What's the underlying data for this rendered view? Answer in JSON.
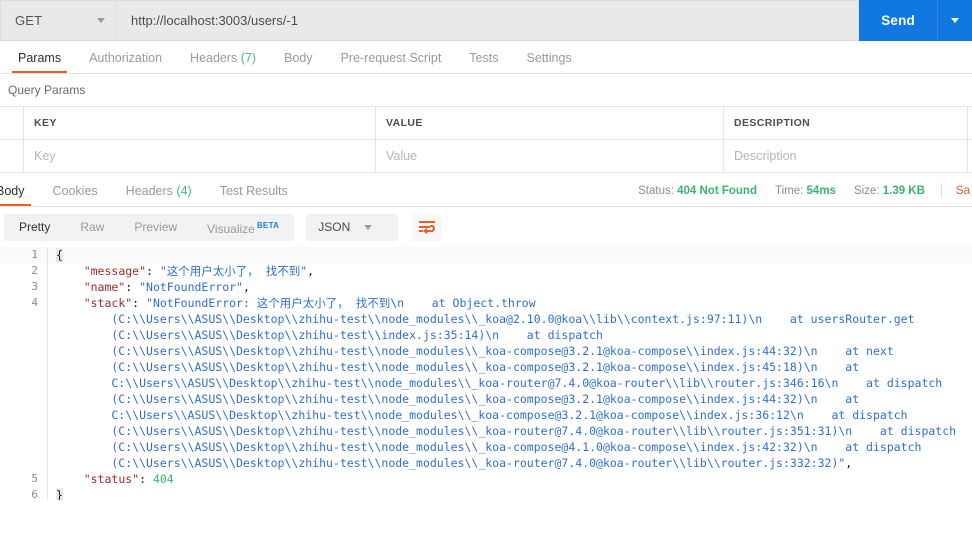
{
  "request": {
    "method": "GET",
    "method_caret_icon": "chevron-down-icon",
    "url": "http://localhost:3003/users/-1",
    "send_label": "Send",
    "send_caret_icon": "chevron-down-icon"
  },
  "request_tabs": [
    {
      "label": "Params",
      "active": true
    },
    {
      "label": "Authorization",
      "active": false
    },
    {
      "label": "Headers",
      "count": "(7)",
      "active": false
    },
    {
      "label": "Body",
      "active": false
    },
    {
      "label": "Pre-request Script",
      "active": false
    },
    {
      "label": "Tests",
      "active": false
    },
    {
      "label": "Settings",
      "active": false
    }
  ],
  "query_params": {
    "section_title": "Query Params",
    "columns": [
      "KEY",
      "VALUE",
      "DESCRIPTION"
    ],
    "placeholder_row": [
      "Key",
      "Value",
      "Description"
    ]
  },
  "response_tabs": [
    {
      "label": "Body",
      "active": true
    },
    {
      "label": "Cookies",
      "active": false
    },
    {
      "label": "Headers",
      "count": "(4)",
      "active": false
    },
    {
      "label": "Test Results",
      "active": false
    }
  ],
  "response_meta": {
    "status_label": "Status:",
    "status_value": "404 Not Found",
    "time_label": "Time:",
    "time_value": "54ms",
    "size_label": "Size:",
    "size_value": "1.39 KB",
    "save_response": "Sa"
  },
  "format_bar": {
    "tabs": [
      {
        "label": "Pretty",
        "active": true
      },
      {
        "label": "Raw",
        "active": false
      },
      {
        "label": "Preview",
        "active": false
      },
      {
        "label": "Visualize",
        "badge": "BETA",
        "active": false
      }
    ],
    "language": "JSON",
    "language_caret_icon": "chevron-down-icon",
    "wrap_button_icon": "wrap-text-icon"
  },
  "colors": {
    "accent_orange": "#ef5b25",
    "send_blue": "#1078e0",
    "status_green": "#3bb273",
    "beta_blue": "#1a7fe0",
    "json_key": "#a52a2a",
    "json_string": "#2f6fd0",
    "json_number": "#3bb273"
  },
  "response_body": {
    "lines": [
      {
        "num": "1",
        "segments": [
          {
            "t": "{",
            "c": "brace"
          }
        ]
      },
      {
        "num": "2",
        "segments": [
          {
            "t": "    ",
            "c": "p"
          },
          {
            "t": "\"message\"",
            "c": "k"
          },
          {
            "t": ": ",
            "c": "p"
          },
          {
            "t": "\"这个用户太小了， 找不到\"",
            "c": "s"
          },
          {
            "t": ",",
            "c": "p"
          }
        ]
      },
      {
        "num": "3",
        "segments": [
          {
            "t": "    ",
            "c": "p"
          },
          {
            "t": "\"name\"",
            "c": "k"
          },
          {
            "t": ": ",
            "c": "p"
          },
          {
            "t": "\"NotFoundError\"",
            "c": "s"
          },
          {
            "t": ",",
            "c": "p"
          }
        ]
      },
      {
        "num": "4",
        "segments": [
          {
            "t": "    ",
            "c": "p"
          },
          {
            "t": "\"stack\"",
            "c": "k"
          },
          {
            "t": ": ",
            "c": "p"
          },
          {
            "t": "\"NotFoundError: 这个用户太小了， 找不到\\n    at Object.throw",
            "c": "s"
          }
        ]
      },
      {
        "num": "",
        "segments": [
          {
            "t": "        (C:\\\\Users\\\\ASUS\\\\Desktop\\\\zhihu-test\\\\node_modules\\\\_koa@2.10.0@koa\\\\lib\\\\context.js:97:11)\\n    at usersRouter.get",
            "c": "s"
          }
        ]
      },
      {
        "num": "",
        "segments": [
          {
            "t": "        (C:\\\\Users\\\\ASUS\\\\Desktop\\\\zhihu-test\\\\index.js:35:14)\\n    at dispatch",
            "c": "s"
          }
        ]
      },
      {
        "num": "",
        "segments": [
          {
            "t": "        (C:\\\\Users\\\\ASUS\\\\Desktop\\\\zhihu-test\\\\node_modules\\\\_koa-compose@3.2.1@koa-compose\\\\index.js:44:32)\\n    at next",
            "c": "s"
          }
        ]
      },
      {
        "num": "",
        "segments": [
          {
            "t": "        (C:\\\\Users\\\\ASUS\\\\Desktop\\\\zhihu-test\\\\node_modules\\\\_koa-compose@3.2.1@koa-compose\\\\index.js:45:18)\\n    at",
            "c": "s"
          }
        ]
      },
      {
        "num": "",
        "segments": [
          {
            "t": "        C:\\\\Users\\\\ASUS\\\\Desktop\\\\zhihu-test\\\\node_modules\\\\_koa-router@7.4.0@koa-router\\\\lib\\\\router.js:346:16\\n    at dispatch",
            "c": "s"
          }
        ]
      },
      {
        "num": "",
        "segments": [
          {
            "t": "        (C:\\\\Users\\\\ASUS\\\\Desktop\\\\zhihu-test\\\\node_modules\\\\_koa-compose@3.2.1@koa-compose\\\\index.js:44:32)\\n    at",
            "c": "s"
          }
        ]
      },
      {
        "num": "",
        "segments": [
          {
            "t": "        C:\\\\Users\\\\ASUS\\\\Desktop\\\\zhihu-test\\\\node_modules\\\\_koa-compose@3.2.1@koa-compose\\\\index.js:36:12\\n    at dispatch",
            "c": "s"
          }
        ]
      },
      {
        "num": "",
        "segments": [
          {
            "t": "        (C:\\\\Users\\\\ASUS\\\\Desktop\\\\zhihu-test\\\\node_modules\\\\_koa-router@7.4.0@koa-router\\\\lib\\\\router.js:351:31)\\n    at dispatch",
            "c": "s"
          }
        ]
      },
      {
        "num": "",
        "segments": [
          {
            "t": "        (C:\\\\Users\\\\ASUS\\\\Desktop\\\\zhihu-test\\\\node_modules\\\\_koa-compose@4.1.0@koa-compose\\\\index.js:42:32)\\n    at dispatch",
            "c": "s"
          }
        ]
      },
      {
        "num": "",
        "segments": [
          {
            "t": "        (C:\\\\Users\\\\ASUS\\\\Desktop\\\\zhihu-test\\\\node_modules\\\\_koa-router@7.4.0@koa-router\\\\lib\\\\router.js:332:32)\"",
            "c": "s"
          },
          {
            "t": ",",
            "c": "p"
          }
        ]
      },
      {
        "num": "5",
        "segments": [
          {
            "t": "    ",
            "c": "p"
          },
          {
            "t": "\"status\"",
            "c": "k"
          },
          {
            "t": ": ",
            "c": "p"
          },
          {
            "t": "404",
            "c": "n"
          }
        ]
      },
      {
        "num": "6",
        "segments": [
          {
            "t": "}",
            "c": "brace"
          }
        ]
      }
    ]
  }
}
